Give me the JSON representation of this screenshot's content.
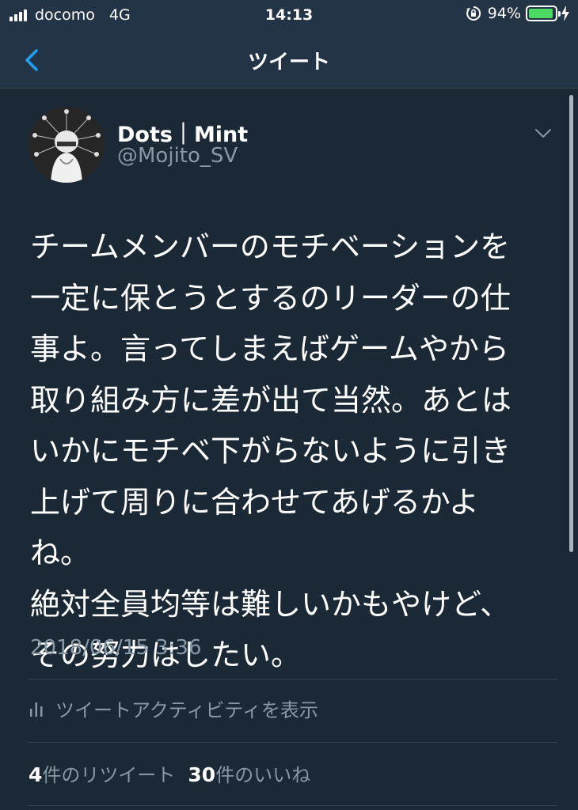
{
  "status_bar": {
    "carrier": "docomo",
    "network": "4G",
    "time": "14:13",
    "battery_pct": "94%",
    "battery_level": 0.94,
    "battery_color": "#4cd964"
  },
  "nav": {
    "back_icon": "chevron-left-icon",
    "title": "ツイート",
    "accent": "#1da1f2"
  },
  "tweet": {
    "display_name": "Dots｜Mint",
    "username": "@Mojito_SV",
    "text_lines": [
      "チームメンバーのモチベーションを",
      "一定に保とうとするのリーダーの仕",
      "事よ。言ってしまえばゲームやから",
      "取り組み方に差が出て当然。あとは",
      "いかにモチベ下がらないように引き",
      "上げて周りに合わせてあげるかよ",
      "ね。",
      "絶対全員均等は難しいかもやけど、",
      "その努力はしたい。"
    ],
    "timestamp": "2018/06/15 3:36",
    "activity_label": "ツイートアクティビティを表示",
    "retweets": {
      "count": "4",
      "label": "件のリツイート"
    },
    "likes": {
      "count": "30",
      "label": "件のいいね"
    }
  },
  "colors": {
    "background": "#1b2836",
    "bar": "#243447",
    "secondary_text": "#8899a6",
    "divider": "#38444d"
  }
}
